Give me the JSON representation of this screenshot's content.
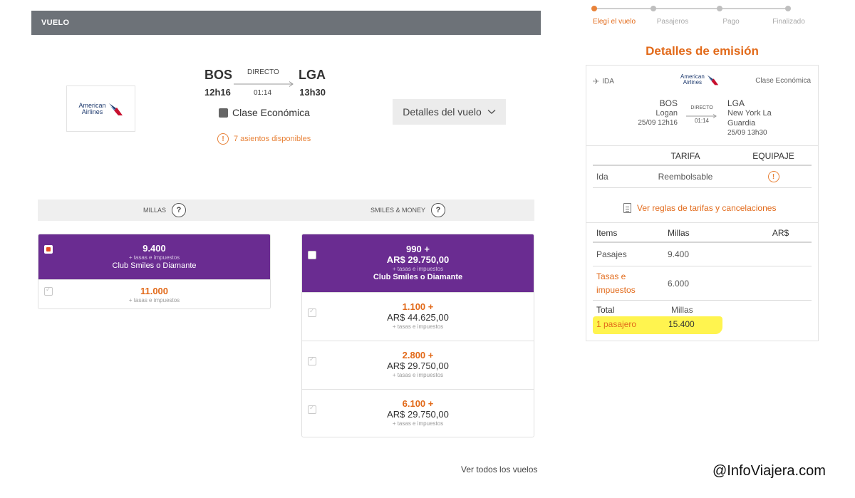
{
  "vuelo": {
    "header": "VUELO",
    "airline_logo": {
      "line1": "American",
      "line2": "Airlines"
    },
    "origin": {
      "code": "BOS",
      "time": "12h16"
    },
    "destination": {
      "code": "LGA",
      "time": "13h30"
    },
    "type": "DIRECTO",
    "duration": "01:14",
    "cabin": "Clase Económica",
    "seats": "7 asientos disponibles",
    "details_button": "Detalles del vuelo"
  },
  "tabs": [
    {
      "label": "MILLAS",
      "help": "?"
    },
    {
      "label": "SMILES & MONEY",
      "help": "?"
    }
  ],
  "millas_options": [
    {
      "value": "9.400",
      "tax": "+ tasas e impuestos",
      "club": "Club Smiles o Diamante",
      "selected": true
    },
    {
      "value": "11.000",
      "tax": "+ tasas e impuestos",
      "selected": false
    }
  ],
  "smiles_money_options": [
    {
      "value": "990 +",
      "ars": "AR$ 29.750,00",
      "tax": "+ tasas e impuestos",
      "club": "Club Smiles o Diamante",
      "selected": true
    },
    {
      "value": "1.100 +",
      "ars": "AR$ 44.625,00",
      "tax": "+ tasas e impuestos",
      "selected": false
    },
    {
      "value": "2.800 +",
      "ars": "AR$ 29.750,00",
      "tax": "+ tasas e impuestos",
      "selected": false
    },
    {
      "value": "6.100 +",
      "ars": "AR$ 29.750,00",
      "tax": "+ tasas e impuestos",
      "selected": false
    }
  ],
  "ver_todos": "Ver todos los vuelos",
  "stepper": [
    {
      "label": "Elegí el vuelo",
      "active": true
    },
    {
      "label": "Pasajeros",
      "active": false
    },
    {
      "label": "Pago",
      "active": false
    },
    {
      "label": "Finalizado",
      "active": false
    }
  ],
  "emision": {
    "title": "Detalles de emisión",
    "ida": "IDA",
    "airline_logo": {
      "line1": "American",
      "line2": "Airlines"
    },
    "clase": "Clase Económica",
    "from": {
      "code": "BOS",
      "airport": "Logan",
      "datetime": "25/09 12h16"
    },
    "to": {
      "code": "LGA",
      "airport_line1": "New York La",
      "airport_line2": "Guardia",
      "datetime": "25/09 13h30"
    },
    "type": "DIRECTO",
    "duration": "01:14",
    "tarifa_headers": {
      "col1": "",
      "tarifa": "TARIFA",
      "equipaje": "EQUIPAJE"
    },
    "tarifa_row": {
      "tramo": "Ida",
      "tarifa": "Reembolsable",
      "equipaje_icon": "!"
    },
    "reglas_link": "Ver reglas de tarifas y cancelaciones",
    "items_headers": {
      "items": "Items",
      "millas": "Millas",
      "ars": "AR$"
    },
    "items_rows": [
      {
        "label": "Pasajes",
        "millas": "9.400",
        "ars": ""
      },
      {
        "label_line1": "Tasas e",
        "label_line2": "impuestos",
        "millas": "6.000",
        "ars": ""
      }
    ],
    "total": {
      "label": "Total",
      "millas_label": "Millas",
      "pasajero": "1 pasajero",
      "value": "15.400"
    }
  },
  "watermark": "@InfoViajera.com",
  "colors": {
    "accent": "#e26a1a",
    "purple": "#6a2c91",
    "header_gray": "#6d7278",
    "highlight": "#fff44f"
  }
}
